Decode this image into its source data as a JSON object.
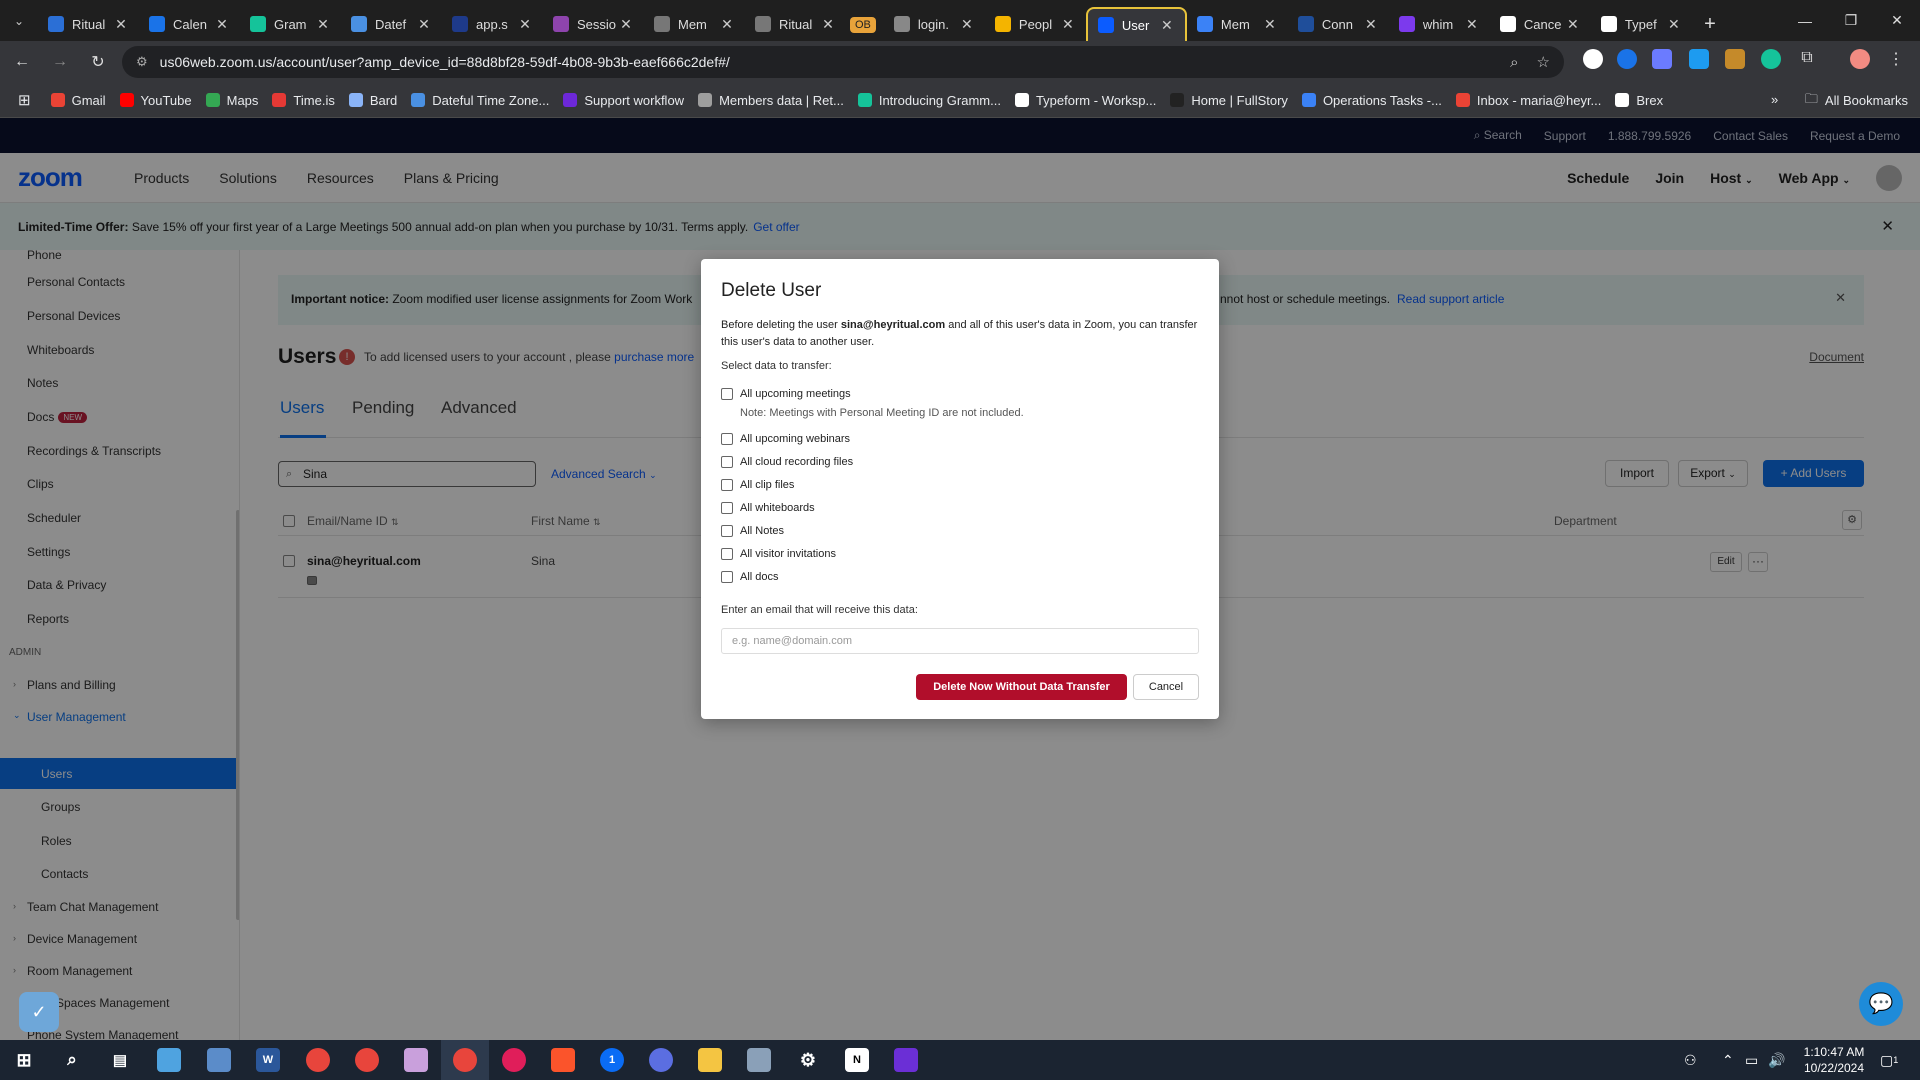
{
  "browser": {
    "tabs": [
      {
        "label": "Ritual",
        "color": "#2b6fd6"
      },
      {
        "label": "Calen",
        "color": "#1a73e8"
      },
      {
        "label": "Gram",
        "color": "#15c39a"
      },
      {
        "label": "Datef",
        "color": "#4a90e2"
      },
      {
        "label": "app.s",
        "color": "#1e3a8a"
      },
      {
        "label": "Sessio",
        "color": "#8e44ad"
      },
      {
        "label": "Mem",
        "color": "#777777"
      },
      {
        "label": "Ritual",
        "color": "#777777"
      },
      {
        "label": "login.",
        "color": "#888888"
      },
      {
        "label": "Peopl",
        "color": "#f4b400"
      },
      {
        "label": "User",
        "color": "#0b5cff",
        "active": true
      },
      {
        "label": "Mem",
        "color": "#3b82f6"
      },
      {
        "label": "Conn",
        "color": "#1f4e9a"
      },
      {
        "label": "whim",
        "color": "#7c3aed"
      },
      {
        "label": "Cance",
        "color": "#ffffff"
      },
      {
        "label": "Typef",
        "color": "#ffffff"
      }
    ],
    "ob_badge": "OB",
    "url": "us06web.zoom.us/account/user?amp_device_id=88d8bf28-59df-4b08-9b3b-eaef666c2def#/",
    "bookmarks": [
      {
        "label": "Gmail",
        "color": "#ea4335"
      },
      {
        "label": "YouTube",
        "color": "#ff0000"
      },
      {
        "label": "Maps",
        "color": "#34a853"
      },
      {
        "label": "Time.is",
        "color": "#e53935"
      },
      {
        "label": "Bard",
        "color": "#8ab4f8"
      },
      {
        "label": "Dateful Time Zone...",
        "color": "#4a90e2"
      },
      {
        "label": "Support workflow",
        "color": "#6d28d9"
      },
      {
        "label": "Members data | Ret...",
        "color": "#9e9e9e"
      },
      {
        "label": "Introducing Gramm...",
        "color": "#15c39a"
      },
      {
        "label": "Typeform - Worksp...",
        "color": "#ffffff"
      },
      {
        "label": "Home | FullStory",
        "color": "#222222"
      },
      {
        "label": "Operations Tasks -...",
        "color": "#3b82f6"
      },
      {
        "label": "Inbox - maria@heyr...",
        "color": "#ea4335"
      },
      {
        "label": "Brex",
        "color": "#ffffff"
      }
    ],
    "all_bookmarks": "All Bookmarks"
  },
  "zoom": {
    "topstrip": [
      "Search",
      "Support",
      "1.888.799.5926",
      "Contact Sales",
      "Request a Demo"
    ],
    "logo": "zoom",
    "nav": [
      "Products",
      "Solutions",
      "Resources",
      "Plans & Pricing"
    ],
    "nav_right": [
      "Schedule",
      "Join",
      "Host",
      "Web App"
    ],
    "offer": {
      "bold": "Limited-Time Offer:",
      "text": "Save 15% off your first year of a Large Meetings 500 annual add-on plan when you purchase by 10/31. Terms apply.",
      "link": "Get offer"
    },
    "sidebar": {
      "items": [
        "Phone",
        "Personal Contacts",
        "Personal Devices",
        "Whiteboards",
        "Notes",
        "Docs",
        "Recordings & Transcripts",
        "Clips",
        "Scheduler",
        "Settings",
        "Data & Privacy",
        "Reports"
      ],
      "docs_badge": "NEW",
      "admin_label": "ADMIN",
      "admin_items": [
        "Plans and Billing",
        "User Management"
      ],
      "user_mgmt_children": [
        "Users",
        "Groups",
        "Roles",
        "Contacts"
      ],
      "more_items": [
        "Team Chat Management",
        "Device Management",
        "Room Management",
        "Spaces Management",
        "Phone System Management"
      ]
    },
    "notice": {
      "bold": "Important notice:",
      "text": "Zoom modified user license assignments for Zoom Work",
      "text_tail": "nnot host or schedule meetings.",
      "link": "Read support article"
    },
    "users_title": "Users",
    "users_sub": "To add licensed users to your account ,  please",
    "users_sub_link": "purchase more",
    "document_link": "Document",
    "tabs": [
      "Users",
      "Pending",
      "Advanced"
    ],
    "search_value": "Sina",
    "advanced_search": "Advanced Search",
    "buttons": {
      "import": "Import",
      "export": "Export",
      "add_users": "+ Add Users"
    },
    "table": {
      "headers": [
        "Email/Name ID",
        "First Name",
        "Department"
      ],
      "rows": [
        {
          "email": "sina@heyritual.com",
          "first_name": "Sina",
          "edit": "Edit",
          "more": "···"
        }
      ]
    }
  },
  "modal": {
    "title": "Delete User",
    "desc_pre": "Before deleting the user",
    "desc_email": "sina@heyritual.com",
    "desc_post": "and all of this user's data in Zoom, you can transfer this user's data to another user.",
    "select_label": "Select data to transfer:",
    "options": [
      "All upcoming meetings",
      "All upcoming webinars",
      "All cloud recording files",
      "All clip files",
      "All whiteboards",
      "All Notes",
      "All visitor invitations",
      "All docs"
    ],
    "note": "Note: Meetings with Personal Meeting ID are not included.",
    "email_label": "Enter an email that will receive this data:",
    "email_placeholder": "e.g. name@domain.com",
    "delete_button": "Delete Now Without Data Transfer",
    "cancel_button": "Cancel"
  },
  "taskbar": {
    "time": "1:10:47 AM",
    "date": "10/22/2024",
    "notif_count": "1"
  }
}
